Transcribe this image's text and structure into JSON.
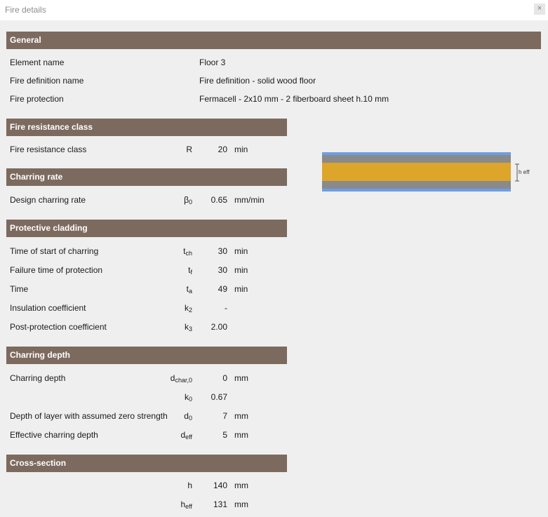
{
  "window": {
    "title": "Fire details",
    "close_icon": "×"
  },
  "general": {
    "header": "General",
    "rows": [
      {
        "label": "Element name",
        "value": "Floor 3"
      },
      {
        "label": "Fire definition name",
        "value": "Fire definition - solid wood floor"
      },
      {
        "label": "Fire protection",
        "value": "Fermacell - 2x10 mm - 2 fiberboard sheet h.10 mm"
      }
    ]
  },
  "fire_resistance": {
    "header": "Fire resistance class",
    "rows": [
      {
        "label": "Fire resistance class",
        "symbol": "R",
        "sub": "",
        "value": "20",
        "unit": "min"
      }
    ]
  },
  "charring_rate": {
    "header": "Charring rate",
    "rows": [
      {
        "label": "Design charring rate",
        "symbol": "β",
        "sub": "0",
        "value": "0.65",
        "unit": "mm/min"
      }
    ]
  },
  "protective_cladding": {
    "header": "Protective cladding",
    "rows": [
      {
        "label": "Time of start of charring",
        "symbol": "t",
        "sub": "ch",
        "value": "30",
        "unit": "min"
      },
      {
        "label": "Failure time of protection",
        "symbol": "t",
        "sub": "f",
        "value": "30",
        "unit": "min"
      },
      {
        "label": "Time",
        "symbol": "t",
        "sub": "a",
        "value": "49",
        "unit": "min"
      },
      {
        "label": "Insulation coefficient",
        "symbol": "k",
        "sub": "2",
        "value": "-",
        "unit": ""
      },
      {
        "label": "Post-protection coefficient",
        "symbol": "k",
        "sub": "3",
        "value": "2.00",
        "unit": ""
      }
    ]
  },
  "charring_depth": {
    "header": "Charring depth",
    "rows": [
      {
        "label": "Charring depth",
        "symbol": "d",
        "sub": "char,0",
        "value": "0",
        "unit": "mm"
      },
      {
        "label": "",
        "symbol": "k",
        "sub": "0",
        "value": "0.67",
        "unit": ""
      },
      {
        "label": "Depth of layer with assumed zero strength",
        "symbol": "d",
        "sub": "0",
        "value": "7",
        "unit": "mm"
      },
      {
        "label": "Effective charring depth",
        "symbol": "d",
        "sub": "eff",
        "value": "5",
        "unit": "mm"
      }
    ]
  },
  "cross_section": {
    "header": "Cross-section",
    "rows": [
      {
        "label": "",
        "symbol": "h",
        "sub": "",
        "value": "140",
        "unit": "mm"
      },
      {
        "label": "",
        "symbol": "h",
        "sub": "eff",
        "value": "131",
        "unit": "mm"
      }
    ],
    "diagram": {
      "dimension_label": "h eff",
      "colors": {
        "cladding": "#6b9ee6",
        "char_layer": "#8a8a8a",
        "core": "#dda52a"
      }
    }
  }
}
